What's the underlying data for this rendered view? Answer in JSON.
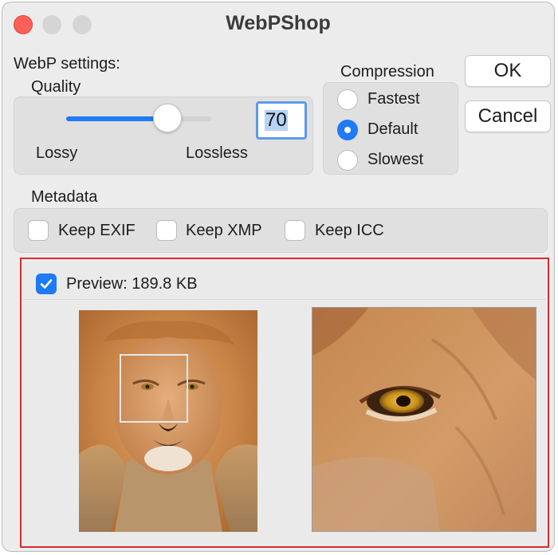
{
  "window": {
    "title": "WebPShop"
  },
  "settings": {
    "heading": "WebP settings:",
    "quality": {
      "label": "Quality",
      "value": "70",
      "slider_fraction": 0.7,
      "min_label": "Lossy",
      "max_label": "Lossless"
    },
    "compression": {
      "label": "Compression",
      "options": [
        "Fastest",
        "Default",
        "Slowest"
      ],
      "selected": "Default"
    },
    "buttons": {
      "ok": "OK",
      "cancel": "Cancel"
    }
  },
  "metadata": {
    "label": "Metadata",
    "options": [
      {
        "label": "Keep EXIF",
        "checked": false
      },
      {
        "label": "Keep XMP",
        "checked": false
      },
      {
        "label": "Keep ICC",
        "checked": false
      }
    ]
  },
  "preview": {
    "label": "Preview: 189.8 KB",
    "checked": true
  },
  "colors": {
    "accent": "#1e7af6",
    "highlight_frame": "#d42d2d",
    "close_button": "#fe5f57"
  }
}
